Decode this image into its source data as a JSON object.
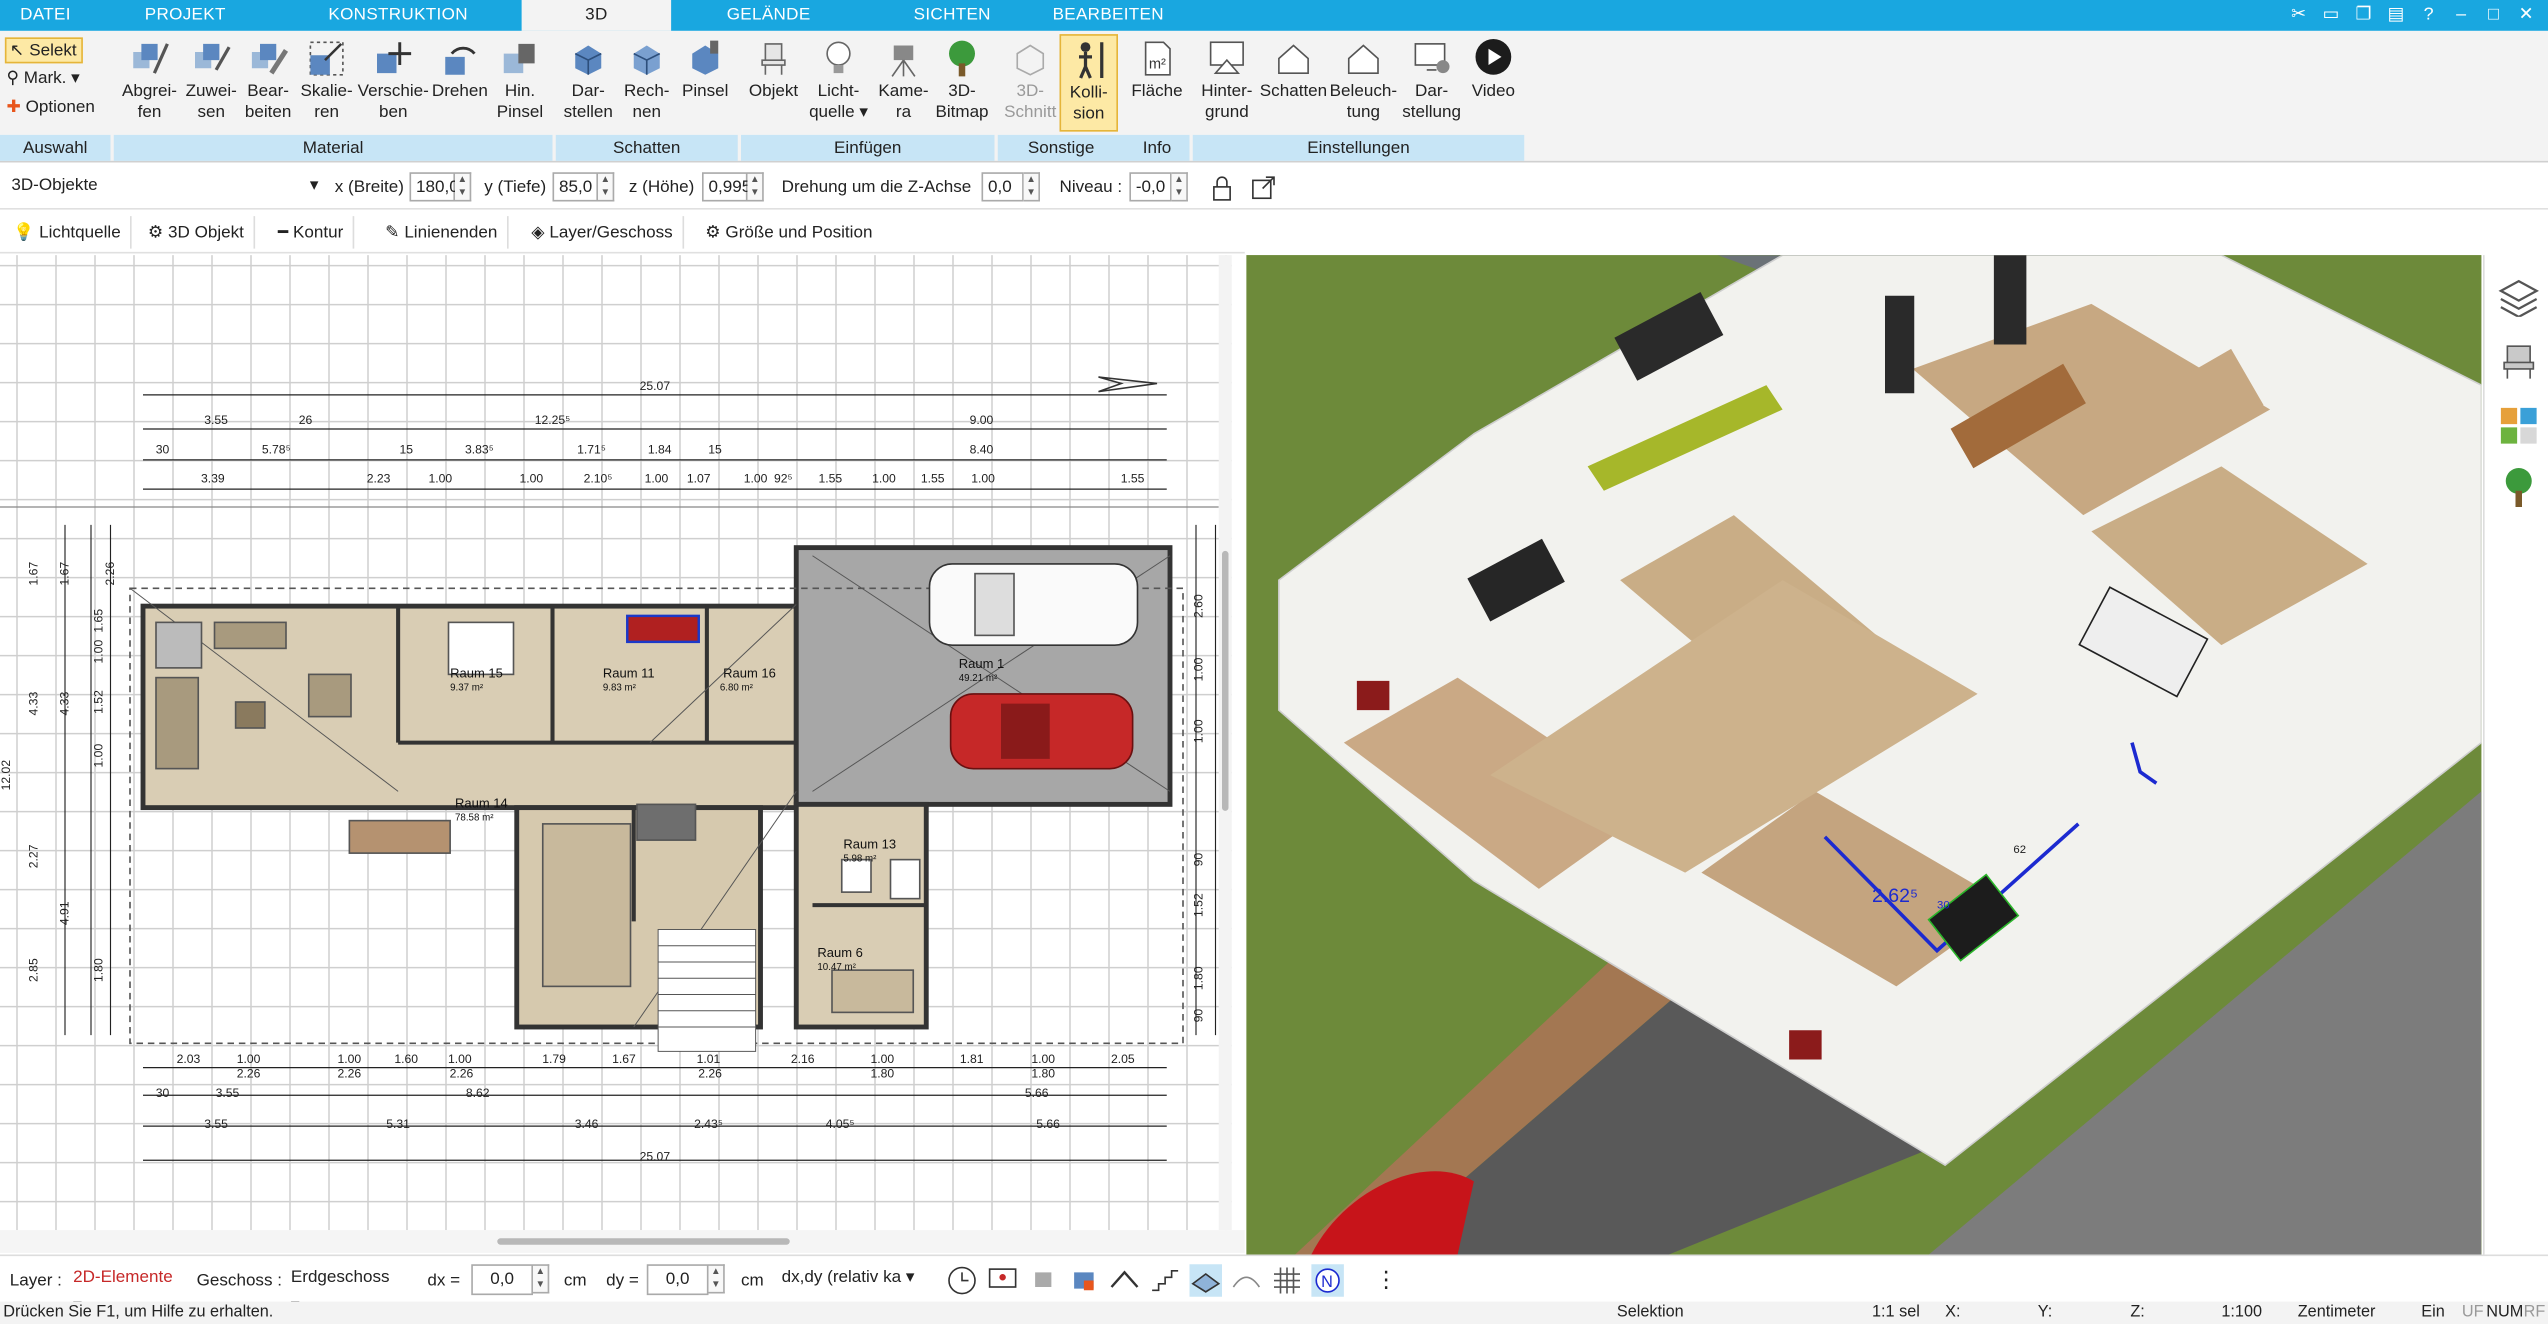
{
  "menu": {
    "tabs": [
      "DATEI",
      "PROJEKT",
      "KONSTRUKTION",
      "3D",
      "GELÄNDE",
      "SICHTEN",
      "BEARBEITEN"
    ],
    "active_tab": "3D"
  },
  "ribbon": {
    "auswahl": {
      "select": "Selekt",
      "mark": "Mark.",
      "options": "Optionen",
      "label": "Auswahl"
    },
    "material": {
      "label": "Material",
      "buttons": [
        {
          "l1": "Abgrei-",
          "l2": "fen"
        },
        {
          "l1": "Zuwei-",
          "l2": "sen"
        },
        {
          "l1": "Bear-",
          "l2": "beiten"
        },
        {
          "l1": "Skalie-",
          "l2": "ren"
        },
        {
          "l1": "Verschie-",
          "l2": "ben"
        },
        {
          "l1": "Drehen",
          "l2": ""
        },
        {
          "l1": "Hin.",
          "l2": "Pinsel"
        }
      ]
    },
    "schatten": {
      "label": "Schatten",
      "buttons": [
        {
          "l1": "Dar-",
          "l2": "stellen"
        },
        {
          "l1": "Rech-",
          "l2": "nen"
        },
        {
          "l1": "Pinsel",
          "l2": ""
        }
      ]
    },
    "einfuegen": {
      "label": "Einfügen",
      "buttons": [
        {
          "l1": "Objekt",
          "l2": ""
        },
        {
          "l1": "Licht-",
          "l2": "quelle ▾"
        },
        {
          "l1": "Kame-",
          "l2": "ra"
        },
        {
          "l1": "3D-",
          "l2": "Bitmap"
        }
      ]
    },
    "sonstige": {
      "label": "Sonstige",
      "buttons": [
        {
          "l1": "3D-",
          "l2": "Schnitt"
        },
        {
          "l1": "Kolli-",
          "l2": "sion"
        }
      ]
    },
    "info": {
      "label": "Info",
      "buttons": [
        {
          "l1": "Fläche",
          "l2": ""
        }
      ]
    },
    "einstellungen": {
      "label": "Einstellungen",
      "buttons": [
        {
          "l1": "Hinter-",
          "l2": "grund"
        },
        {
          "l1": "Schatten",
          "l2": ""
        },
        {
          "l1": "Beleuch-",
          "l2": "tung"
        },
        {
          "l1": "Dar-",
          "l2": "stellung"
        },
        {
          "l1": "Video",
          "l2": ""
        }
      ]
    }
  },
  "properties": {
    "object_type": "3D-Objekte",
    "x_label": "x (Breite)",
    "x_value": "180,0",
    "y_label": "y (Tiefe)",
    "y_value": "85,0",
    "z_label": "z (Höhe)",
    "z_value": "0,995",
    "rot_label": "Drehung um die Z-Achse",
    "rot_value": "0,0",
    "niveau_label": "Niveau :",
    "niveau_value": "-0,0"
  },
  "toolstrip": [
    "Lichtquelle",
    "3D Objekt",
    "Kontur",
    "Linienenden",
    "Layer/Geschoss",
    "Größe und Position"
  ],
  "plan": {
    "rooms": [
      {
        "name": "Raum 15",
        "area": "9.37 m²"
      },
      {
        "name": "Raum 11",
        "area": "9.83 m²"
      },
      {
        "name": "Raum 16",
        "area": "6.80 m²"
      },
      {
        "name": "Raum 1",
        "area": "49.21 m²"
      },
      {
        "name": "Raum 14",
        "area": "78.58 m²"
      },
      {
        "name": "Raum 13",
        "area": "5.98 m²"
      },
      {
        "name": "Raum 6",
        "area": "10.47 m²"
      }
    ],
    "dims_top": [
      "25.07",
      "3.55",
      "26",
      "12.25⁵",
      "9.00",
      "30",
      "5.78⁵",
      "15",
      "3.83⁵",
      "1.71⁵",
      "1.84",
      "15",
      "8.40",
      "3.39",
      "2.23",
      "1.00",
      "1.00",
      "2.10⁵",
      "1.00",
      "1.07",
      "1.00",
      "92⁵",
      "1.55",
      "1.00",
      "1.55",
      "1.00",
      "1.55"
    ],
    "dims_bottom": [
      "2.03",
      "1.00",
      "1.00",
      "1.60",
      "1.00",
      "1.79",
      "1.67",
      "1.01",
      "2.16",
      "1.00",
      "1.81",
      "1.00",
      "2.05",
      "2.26",
      "2.26",
      "2.26",
      "2.26",
      "1.80",
      "1.80",
      "30",
      "3.55",
      "8.62",
      "5.66",
      "3.55",
      "5.31",
      "3.46",
      "2.43⁵",
      "4.05⁵",
      "5.66",
      "25.07"
    ],
    "dims_left": [
      "1.67",
      "1.67",
      "2.26",
      "1.65",
      "1.00",
      "1.52",
      "1.00",
      "2.27",
      "4.91",
      "1.80",
      "2.85",
      "4.33",
      "4.33",
      "12.02"
    ],
    "dims_right": [
      "2.60",
      "1.00",
      "1.00",
      "90",
      "1.52",
      "1.80",
      "90"
    ]
  },
  "view3d": {
    "dim_label": "2.62⁵",
    "dim_sub": "30",
    "dim_small": "62"
  },
  "bottom": {
    "layer_label": "Layer :",
    "layer_value": "2D-Elemente",
    "geschoss_label": "Geschoss :",
    "geschoss_value": "Erdgeschoss",
    "dx_label": "dx =",
    "dx_value": "0,0",
    "dx_unit": "cm",
    "dy_label": "dy =",
    "dy_value": "0,0",
    "dy_unit": "cm",
    "mode_value": "dx,dy (relativ ka"
  },
  "status": {
    "help": "Drücken Sie F1, um Hilfe zu erhalten.",
    "mode": "Selektion",
    "sel": "1:1 sel",
    "x": "X:",
    "y": "Y:",
    "z": "Z:",
    "scale": "1:100",
    "unit": "Zentimeter",
    "ein": "Ein",
    "uf": "UF",
    "num": "NUM",
    "rf": "RF"
  },
  "colors": {
    "accent": "#19a7e0",
    "ribbon_group": "#c7e5f6",
    "active": "#fde9a5",
    "grass": "#6f8f3c"
  }
}
